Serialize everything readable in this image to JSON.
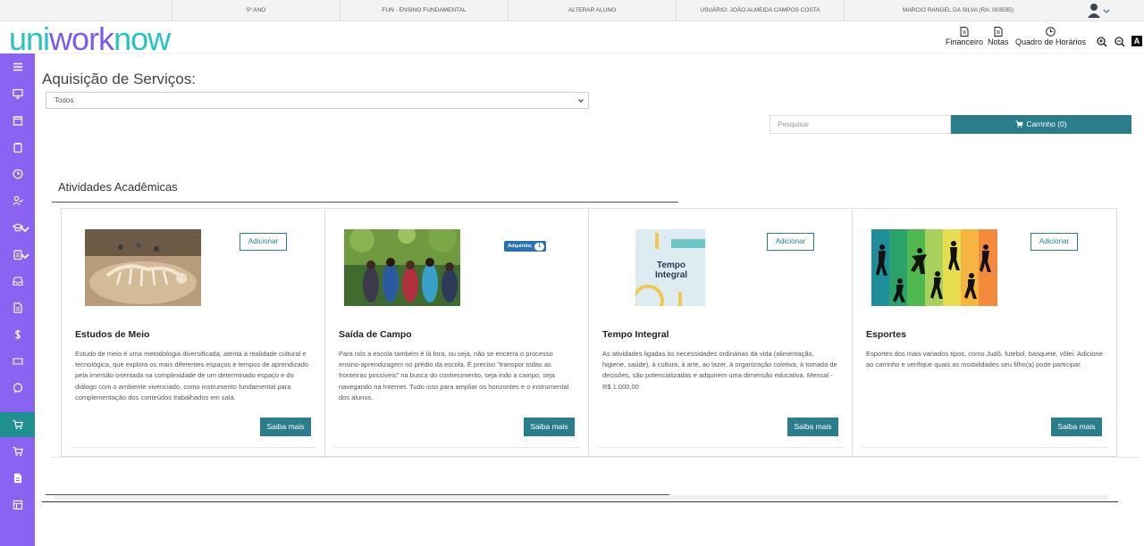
{
  "topbar": {
    "grade": "5º ANO",
    "level": "FUN - ENSINO FUNDAMENTAL",
    "change_student": "ALTERAR ALUNO",
    "user": "USUÁRIO: JOÃO ALMEIDA CAMPOS COSTA",
    "student": "MARCIO RANGEL DA SILVA (RA: 003595)",
    "user_icon": "user-avatar-icon"
  },
  "header": {
    "logo_part1": "uni",
    "logo_part2": "work",
    "logo_part3": "now",
    "links": [
      {
        "label": "Financeiro",
        "icon": "document-icon"
      },
      {
        "label": "Notas",
        "icon": "notes-icon"
      },
      {
        "label": "Quadro de Horários",
        "icon": "clock-icon"
      }
    ],
    "zoom_in": "zoom-in-icon",
    "zoom_out": "zoom-out-icon",
    "contrast_label": "A"
  },
  "sidebar": {
    "items": [
      "menu-icon",
      "monitor-icon",
      "calendar-icon",
      "clipboard-icon",
      "clock-icon",
      "user-check-icon",
      "graduation-cap-icon",
      "clipboard-list-icon",
      "inbox-icon",
      "file-icon",
      "dollar-icon",
      "ticket-icon",
      "chat-icon",
      "cart-icon",
      "cart-icon",
      "document-icon",
      "layout-icon"
    ],
    "active_index": 13
  },
  "main": {
    "title": "Aquisição de Serviços:",
    "filter_value": "Todos",
    "search_placeholder": "Pesquisar",
    "cart_label": "Carrinho (0)",
    "section_title": "Atividades Acadêmicas"
  },
  "cards": [
    {
      "title": "Estudos de Meio",
      "description": "Estudo de meio é uma metodologia diversificada, atenta à realidade cultural e tecnológica, que explora os mais diferentes espaços e tempos de aprendizado pela imersão orientada na complexidade de um determinado espaço e do diálogo com o ambiente vivenciado, como instrumento fundamental para complementação dos conteúdos trabalhados em sala.",
      "action_label": "Adicionar",
      "more_label": "Saiba mais"
    },
    {
      "title": "Saída de Campo",
      "description": "Para nós a escola também é lá fora, ou seja, não se encerra o processo ensino-aprendizagem no prédio da escola. É preciso \"transpor todas as fronteiras possíveis\" na busca do conhecimento, seja indo a campo, seja navegando na Internet. Tudo isso para ampliar os horizontes e o instrumental dos alunos.",
      "badge_label": "Adquirido:",
      "badge_count": "1",
      "more_label": "Saiba mais"
    },
    {
      "title": "Tempo Integral",
      "description": "As atividades ligadas às necessidades ordinárias da vida (alimentação, higiene, saúde), à cultura, à arte, ao lazer, à organização coletiva, à tomada de decisões, são potencializadas e adquirem uma dimensão educativa. Mensal - R$ 1.000,00",
      "image_text_1": "Tempo",
      "image_text_2": "Integral",
      "action_label": "Adicionar",
      "more_label": "Saiba mais"
    },
    {
      "title": "Esportes",
      "description": "Esportes dos mais variados tipos, como Judô, futebol, basquete, vôlei. Adicione ao carrinho e verifique quais as modalidades seu filho(a) pode participar.",
      "action_label": "Adicionar",
      "more_label": "Saiba mais"
    }
  ]
}
